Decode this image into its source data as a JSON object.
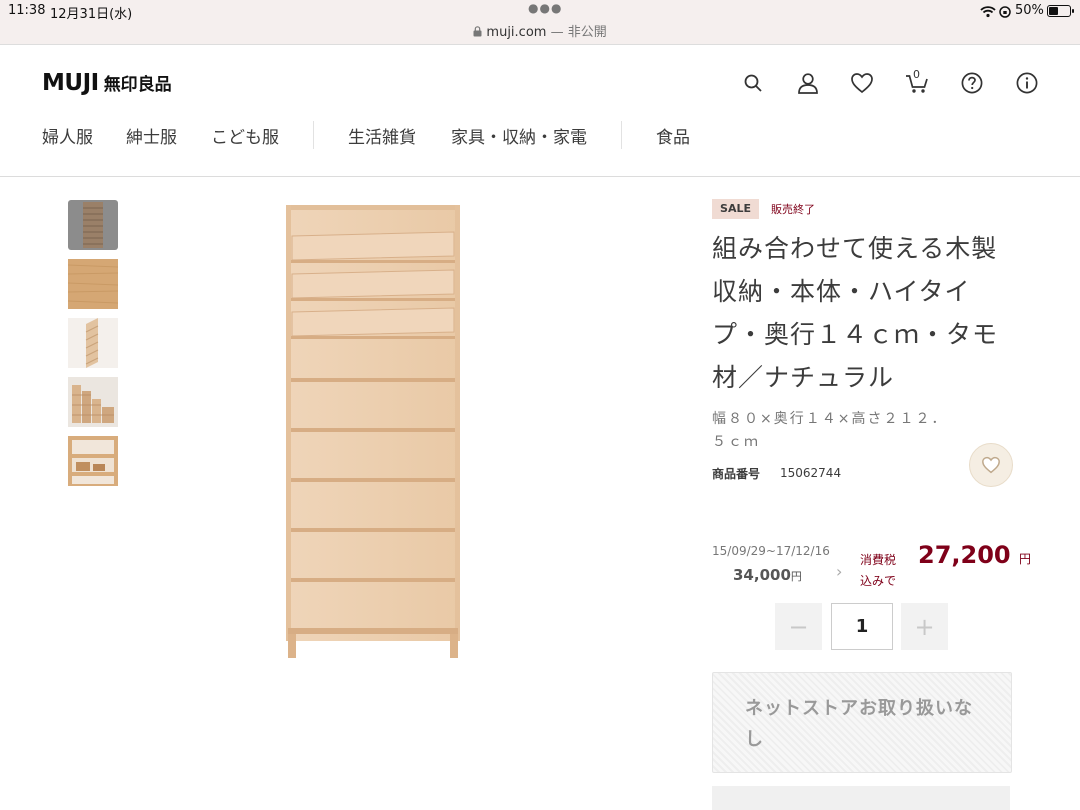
{
  "status_bar": {
    "time": "11:38",
    "date": "12月31日(水)",
    "battery": "50%",
    "battery_level": 0.5
  },
  "address_bar": {
    "domain": "muji.com",
    "privacy": " — 非公開"
  },
  "header": {
    "logo_en": "MUJI",
    "logo_ja": "無印良品",
    "cart_count": "0",
    "icons": [
      "search-icon",
      "user-icon",
      "heart-icon",
      "cart-icon",
      "help-icon",
      "info-icon"
    ]
  },
  "nav": {
    "items": [
      "婦人服",
      "紳士服",
      "こども服",
      "生活雑貨",
      "家具・収納・家電",
      "食品"
    ]
  },
  "product": {
    "sale_badge": "SALE",
    "status": "販売終了",
    "title": "組み合わせて使える木製収納・本体・ハイタイプ・奥行１４ｃｍ・タモ材／ナチュラル",
    "spec": "幅８０×奥行１４×高さ２１２．５ｃｍ",
    "item_number_label": "商品番号",
    "item_number": "15062744",
    "period": "15/09/29~17/12/16",
    "old_price": "34,000",
    "yen": "円",
    "tax_note": "消費税込みで",
    "price": "27,200",
    "quantity": "1",
    "unavailable_text": "ネットストアお取り扱いなし"
  },
  "colors": {
    "accent": "#7f0019",
    "sale_badge_bg": "#f0dbd3",
    "wood": "#e6c6a4"
  }
}
